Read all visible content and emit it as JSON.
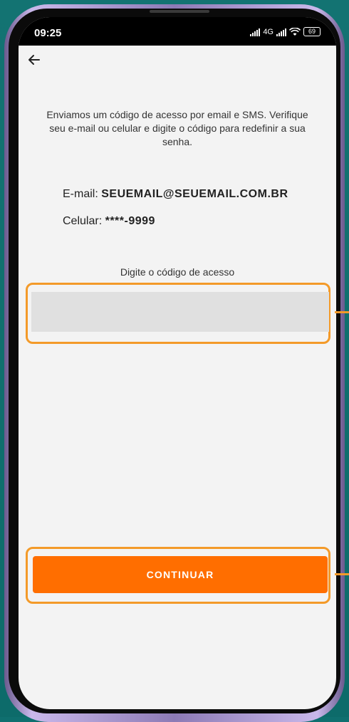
{
  "status_bar": {
    "time": "09:25",
    "network": "4G",
    "battery": "69"
  },
  "header": {
    "back_icon": "arrow-left-icon"
  },
  "intro_text": "Enviamos um código de acesso por email e SMS. Verifique seu e-mail ou celular e digite o código para redefinir a sua senha.",
  "contact": {
    "email_label": "E-mail:",
    "email_value": "SEUEMAIL@SEUEMAIL.COM.BR",
    "phone_label": "Celular:",
    "phone_value": "****-9999"
  },
  "code": {
    "label": "Digite o código de acesso",
    "value": "",
    "placeholder": ""
  },
  "continue_button": {
    "label": "CONTINUAR"
  },
  "colors": {
    "accent": "#ff6e00",
    "highlight": "#f39a29",
    "background": "#137372"
  }
}
